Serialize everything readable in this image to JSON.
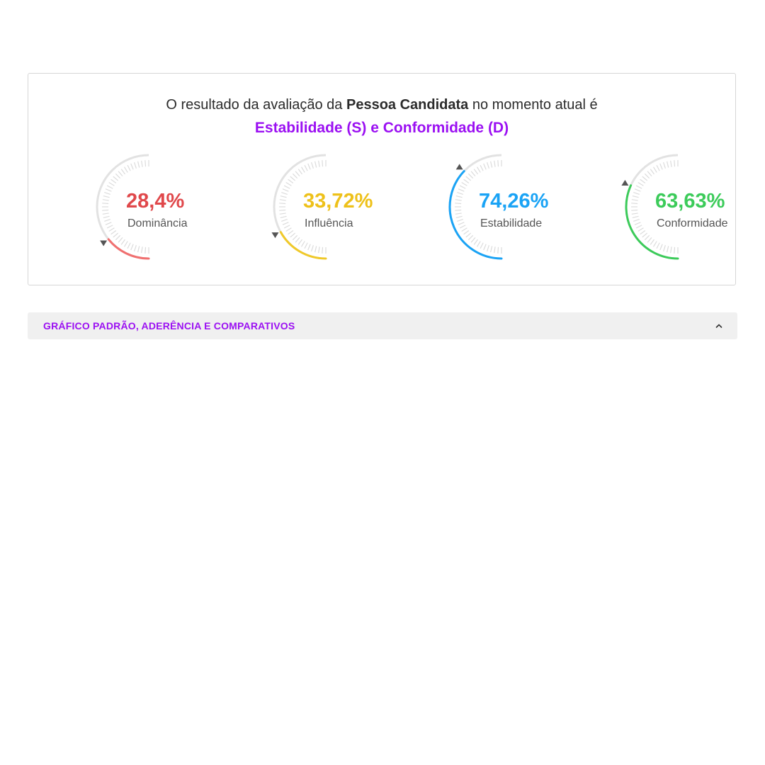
{
  "result": {
    "headline_prefix": "O resultado da avaliação da ",
    "headline_bold": "Pessoa Candidata",
    "headline_suffix": " no momento atual é",
    "profile": "Estabilidade (S) e Conformidade (D)",
    "profile_color": "#9b10f2"
  },
  "gauges": [
    {
      "value_text": "28,4%",
      "label": "Dominância",
      "value": 28.4,
      "color": "#e0484b",
      "arc_color": "#f07070",
      "marker": "down"
    },
    {
      "value_text": "33,72%",
      "label": "Influência",
      "value": 33.72,
      "color": "#eec11a",
      "arc_color": "#f0c929",
      "marker": "down"
    },
    {
      "value_text": "74,26%",
      "label": "Estabilidade",
      "value": 74.26,
      "color": "#1aa3f5",
      "arc_color": "#1aa3f5",
      "marker": "up"
    },
    {
      "value_text": "63,63%",
      "label": "Conformidade",
      "value": 63.63,
      "color": "#3ccb5a",
      "arc_color": "#3ccb5a",
      "marker": "up"
    }
  ],
  "accordion": {
    "title": "GRÁFICO PADRÃO, ADERÊNCIA E COMPARATIVOS",
    "title_color": "#9b10f2",
    "icon": "chevron-up-icon",
    "expanded": false
  }
}
